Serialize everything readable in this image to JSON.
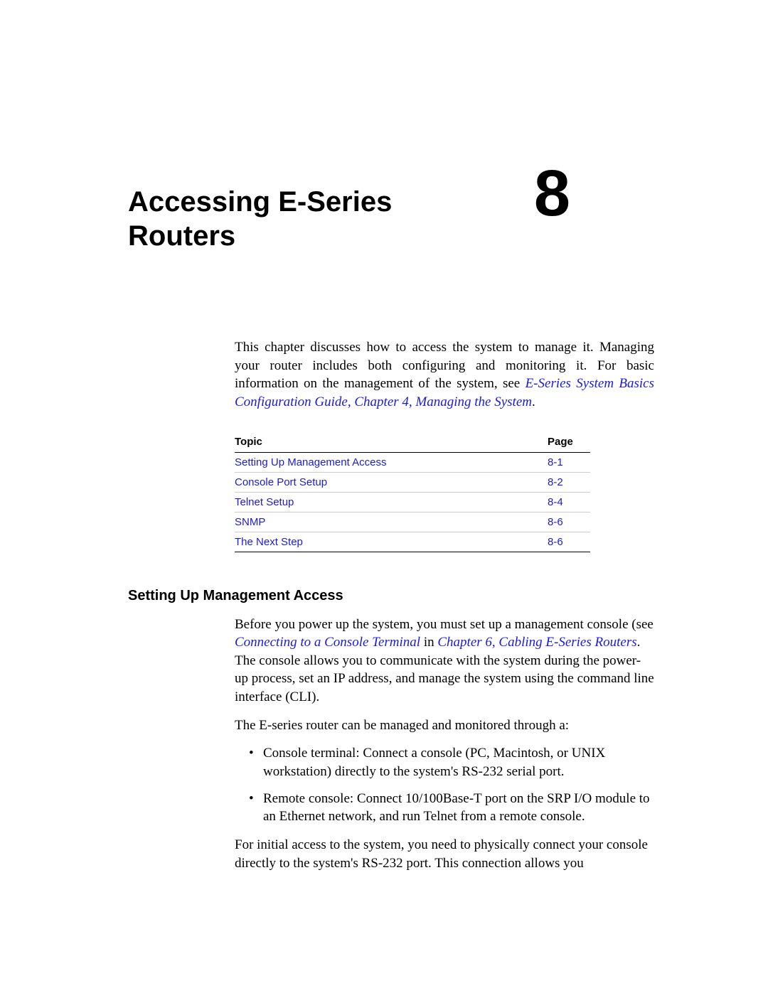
{
  "chapter": {
    "number": "8",
    "title": "Accessing E-Series Routers"
  },
  "intro": {
    "text_before_link": "This chapter discusses how to access the system to manage it. Managing your router includes both configuring and monitoring it. For basic information on the management of the system, see ",
    "link_text": "E-Series System Basics Configuration Guide, Chapter 4, Managing the System",
    "text_after_link": "."
  },
  "toc": {
    "header_topic": "Topic",
    "header_page": "Page",
    "rows": [
      {
        "topic": "Setting Up Management Access",
        "page": "8-1"
      },
      {
        "topic": "Console Port Setup",
        "page": "8-2"
      },
      {
        "topic": "Telnet Setup",
        "page": "8-4"
      },
      {
        "topic": "SNMP",
        "page": "8-6"
      },
      {
        "topic": "The Next Step",
        "page": "8-6"
      }
    ]
  },
  "section": {
    "heading": "Setting Up Management Access",
    "para1_before": "Before you power up the system, you must set up a management console (see ",
    "para1_link1": "Connecting to a Console Terminal",
    "para1_mid": " in ",
    "para1_link2": "Chapter 6, Cabling E-Series Routers",
    "para1_after": ". The console allows you to communicate with the system during the power-up process, set an IP address, and manage the system using the command line interface (CLI).",
    "para2": "The E-series router can be managed and monitored through a:",
    "bullets": [
      "Console terminal: Connect a console (PC, Macintosh, or UNIX workstation) directly to the system's RS-232 serial port.",
      "Remote console: Connect 10/100Base-T port on the SRP I/O module to an Ethernet network, and run Telnet from a remote console."
    ],
    "para3": "For initial access to the system, you need to physically connect your console directly to the system's RS-232 port. This connection allows you"
  }
}
